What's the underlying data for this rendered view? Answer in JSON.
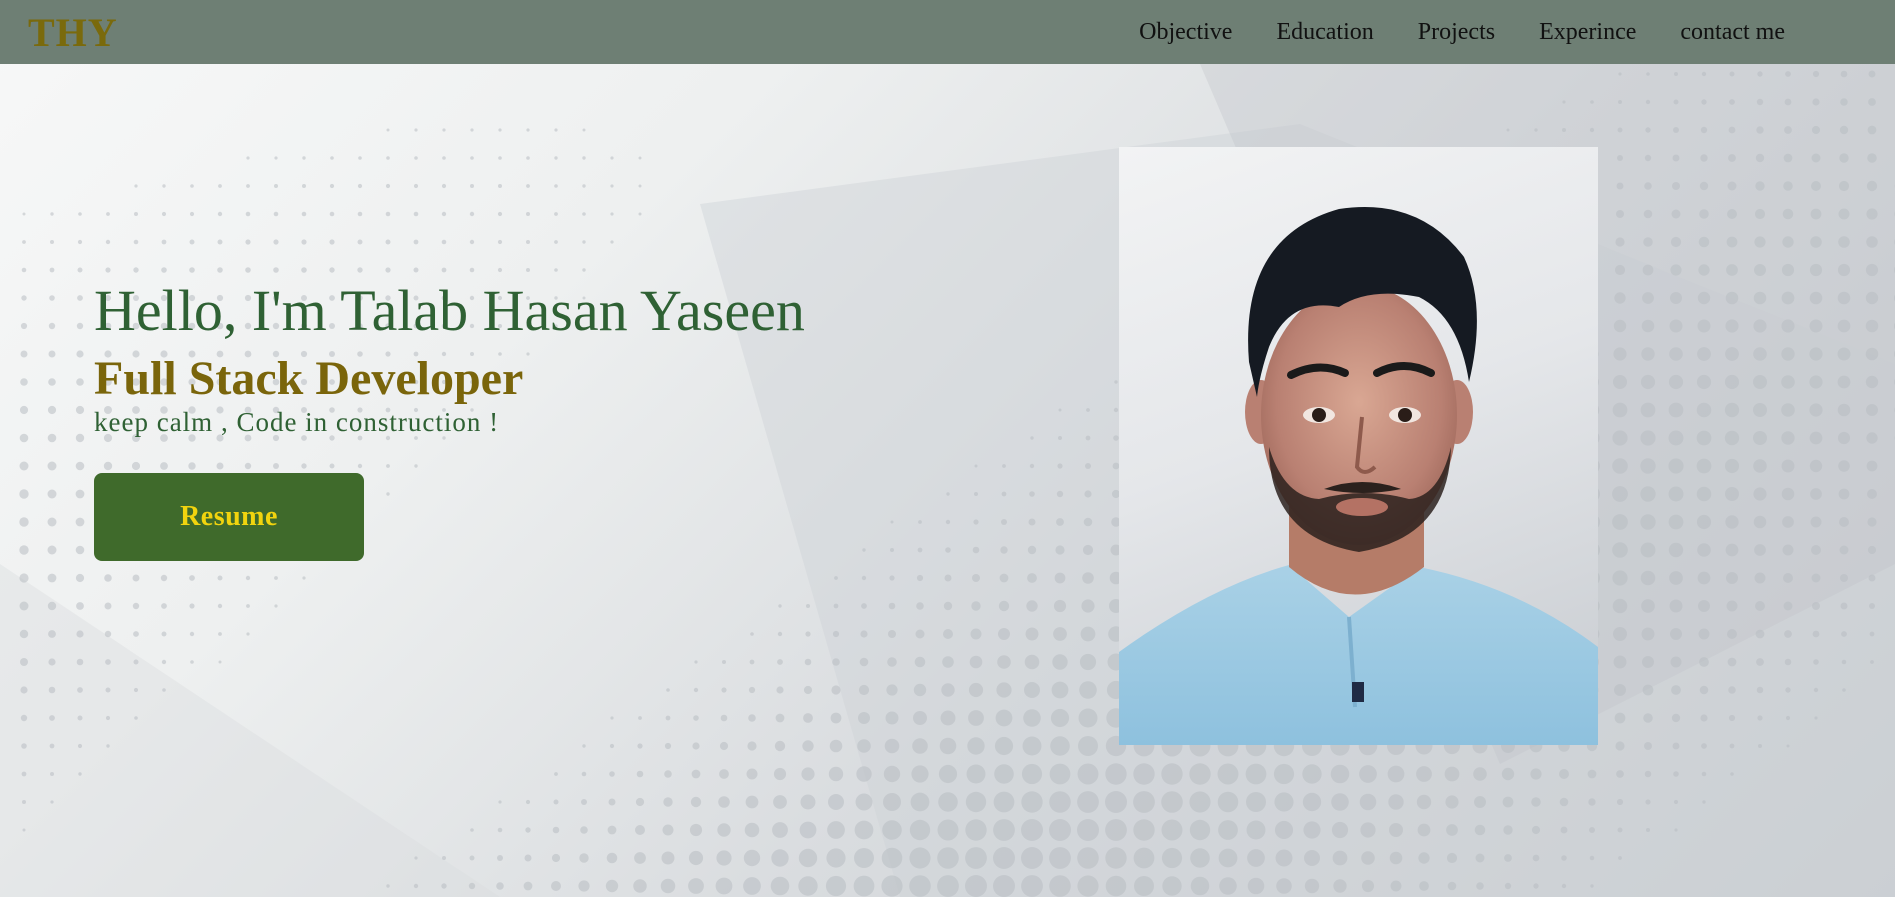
{
  "navbar": {
    "logo": "THY",
    "links": [
      "Objective",
      "Education",
      "Projects",
      "Experince",
      "contact me"
    ]
  },
  "hero": {
    "greeting": "Hello, I'm Talab Hasan Yaseen",
    "role": "Full Stack Developer",
    "tagline": "keep calm , Code in construction !",
    "resume_label": "Resume"
  },
  "colors": {
    "navbar_bg": "#6e7f74",
    "logo": "#7a6a0c",
    "greeting": "#2f6134",
    "role": "#7a650b",
    "button_bg": "#3f6a2b",
    "button_text": "#f1d40e"
  }
}
